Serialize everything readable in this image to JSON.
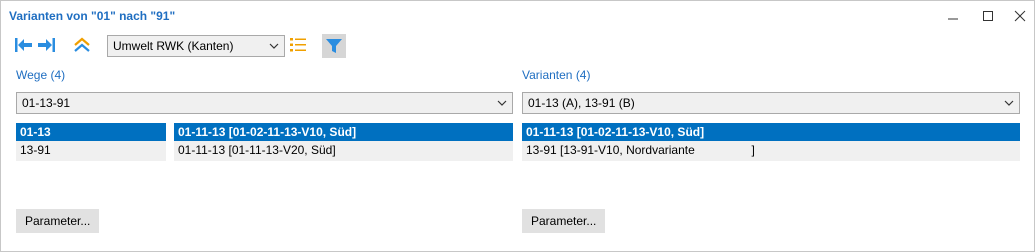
{
  "window": {
    "title": "Varianten von \"01\" nach \"91\"",
    "minimize_glyph": "—",
    "maximize_glyph": "☐",
    "close_glyph": "✕"
  },
  "toolbar": {
    "icons": [
      "first-icon",
      "next-icon",
      "collapse-up-icon",
      "list-icon",
      "filter-icon"
    ],
    "scenario_select": "Umwelt RWK (Kanten)",
    "accent": "#1f6ec1",
    "icon_orange": "#f0a000"
  },
  "wege": {
    "label": "Wege (4)",
    "select_value": "01-13-91",
    "left_list": [
      "01-13",
      "13-91"
    ],
    "right_list": [
      "01-11-13 [01-02-11-13-V10, Süd]",
      "01-11-13 [01-11-13-V20, Süd]"
    ],
    "parameter_button": "Parameter..."
  },
  "varianten": {
    "label": "Varianten (4)",
    "select_value": "01-13 (A), 13-91 (B)",
    "list": [
      "01-11-13 [01-02-11-13-V10, Süd]",
      "13-91 [13-91-V10, Nordvariante                 ]"
    ],
    "parameter_button": "Parameter..."
  }
}
